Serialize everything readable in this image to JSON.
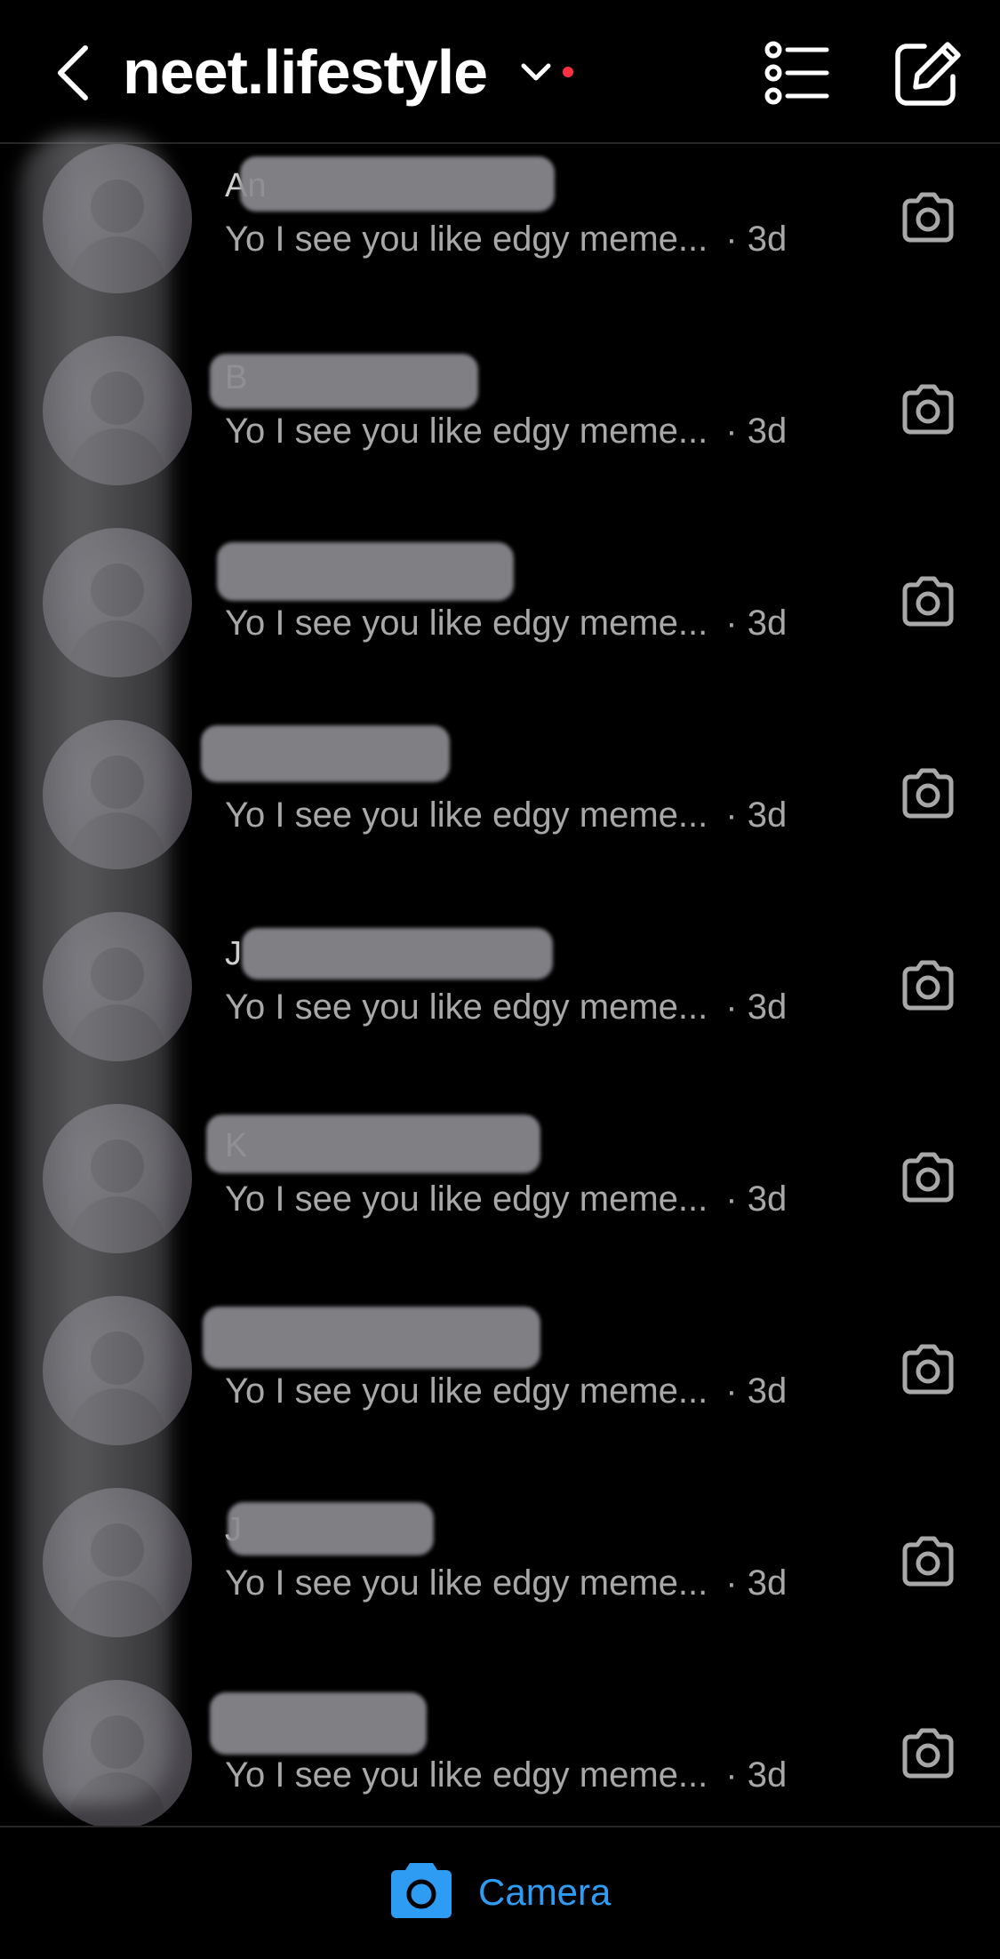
{
  "header": {
    "account_name": "neet.lifestyle",
    "icons": {
      "back": "chevron-left-icon",
      "switch": "chevron-down-icon",
      "list": "list-icon",
      "compose": "compose-icon"
    },
    "notification_color": "#ff3040"
  },
  "threads": [
    {
      "name": "An",
      "preview": "Yo I see you like edgy meme...",
      "time": "· 3d"
    },
    {
      "name": "B",
      "preview": "Yo I see you like edgy meme...",
      "time": "· 3d"
    },
    {
      "name": "",
      "preview": "Yo I see you like edgy meme...",
      "time": "· 3d"
    },
    {
      "name": "",
      "preview": "Yo I see you like edgy meme...",
      "time": "· 3d"
    },
    {
      "name": "J",
      "preview": "Yo I see you like edgy meme...",
      "time": "· 3d"
    },
    {
      "name": "K",
      "preview": "Yo I see you like edgy meme...",
      "time": "· 3d"
    },
    {
      "name": "",
      "preview": "Yo I see you like edgy meme...",
      "time": "· 3d"
    },
    {
      "name": "J",
      "preview": "Yo I see you like edgy meme...",
      "time": "· 3d"
    },
    {
      "name": "",
      "preview": "Yo I see you like edgy meme...",
      "time": "· 3d"
    }
  ],
  "bottom": {
    "camera_label": "Camera",
    "accent_color": "#2f9cf4"
  }
}
